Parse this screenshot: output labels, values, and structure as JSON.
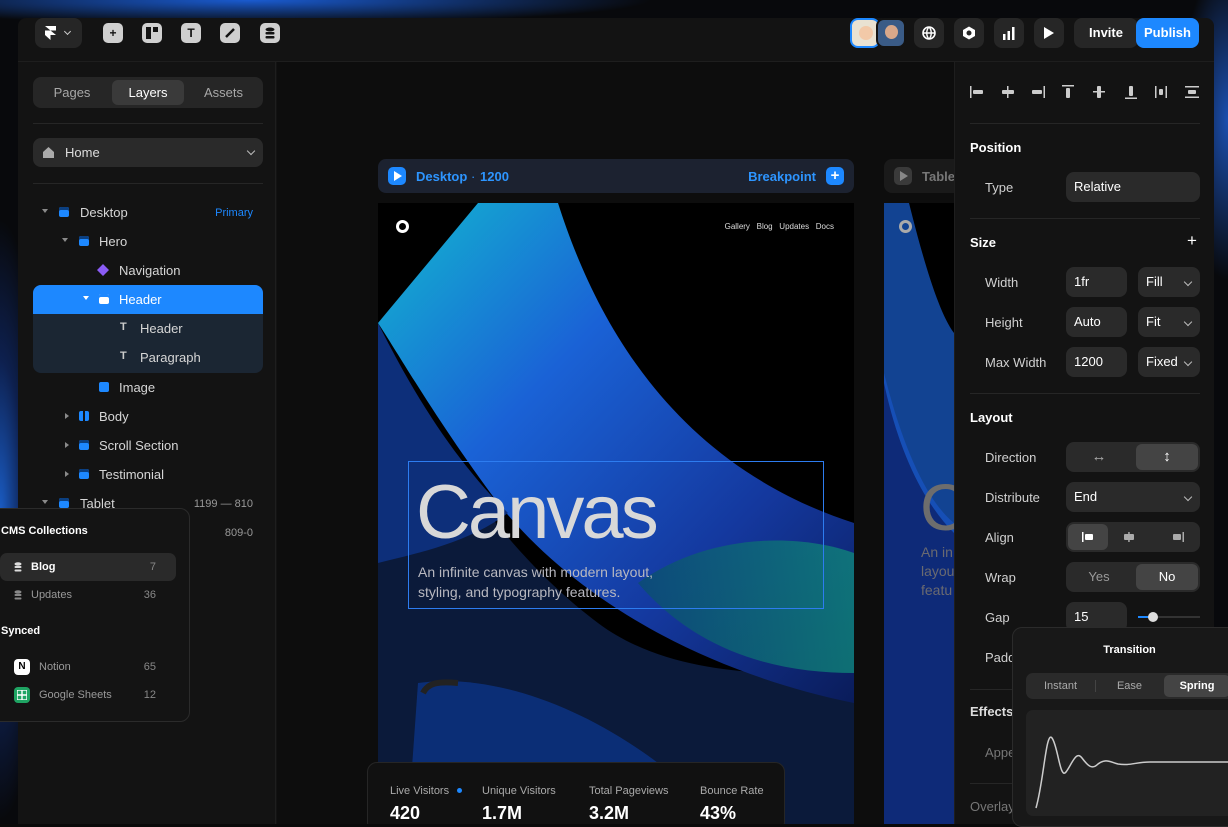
{
  "topbar": {
    "invite_label": "Invite",
    "publish_label": "Publish",
    "tools": [
      "add-icon",
      "layout-icon",
      "text-icon",
      "pen-icon",
      "database-icon"
    ],
    "actions": [
      "globe-icon",
      "settings-icon",
      "analytics-icon",
      "play-icon"
    ]
  },
  "left": {
    "tabs": [
      "Pages",
      "Layers",
      "Assets"
    ],
    "active_tab": "Layers",
    "page_select": "Home",
    "layers": [
      {
        "label": "Desktop",
        "badge": "Primary"
      },
      {
        "label": "Hero"
      },
      {
        "label": "Navigation"
      },
      {
        "label": "Header"
      },
      {
        "label": "Header"
      },
      {
        "label": "Paragraph"
      },
      {
        "label": "Image"
      },
      {
        "label": "Body"
      },
      {
        "label": "Scroll Section"
      },
      {
        "label": "Testimonial"
      },
      {
        "label": "Tablet",
        "badge": "1199 — 810"
      },
      {
        "label": "",
        "badge": "809-0"
      }
    ]
  },
  "cms": {
    "title": "CMS Collections",
    "items": [
      {
        "label": "Blog",
        "count": "7"
      },
      {
        "label": "Updates",
        "count": "36"
      }
    ],
    "synced_title": "Synced",
    "synced": [
      {
        "label": "Notion",
        "count": "65"
      },
      {
        "label": "Google Sheets",
        "count": "12"
      }
    ]
  },
  "canvas": {
    "desktop": {
      "label": "Desktop",
      "width": "1200",
      "breakpoint_label": "Breakpoint",
      "nav": [
        "Gallery",
        "Blog",
        "Updates",
        "Docs"
      ],
      "title": "Canvas",
      "subtitle": "An infinite canvas with modern layout, styling, and typography features."
    },
    "tablet": {
      "label": "Tablet",
      "title": "C",
      "subtitle": "An in layou featu"
    },
    "stats": [
      {
        "label": "Live Visitors",
        "value": "420"
      },
      {
        "label": "Unique Visitors",
        "value": "1.7M"
      },
      {
        "label": "Total Pageviews",
        "value": "3.2M"
      },
      {
        "label": "Bounce Rate",
        "value": "43%"
      }
    ]
  },
  "right": {
    "position": {
      "title": "Position",
      "type_label": "Type",
      "type_value": "Relative"
    },
    "size": {
      "title": "Size",
      "width_label": "Width",
      "width_value": "1fr",
      "width_mode": "Fill",
      "height_label": "Height",
      "height_value": "Auto",
      "height_mode": "Fit",
      "maxw_label": "Max Width",
      "maxw_value": "1200",
      "maxw_mode": "Fixed"
    },
    "layout": {
      "title": "Layout",
      "direction_label": "Direction",
      "distribute_label": "Distribute",
      "distribute_value": "End",
      "align_label": "Align",
      "wrap_label": "Wrap",
      "wrap_yes": "Yes",
      "wrap_no": "No",
      "gap_label": "Gap",
      "gap_value": "15",
      "padding_label": "Padd"
    },
    "effects": {
      "title": "Effects",
      "appear_label": "Appe",
      "overlay_label": "Overlay"
    }
  },
  "transition": {
    "title": "Transition",
    "options": [
      "Instant",
      "Ease",
      "Spring"
    ],
    "active": "Spring"
  }
}
